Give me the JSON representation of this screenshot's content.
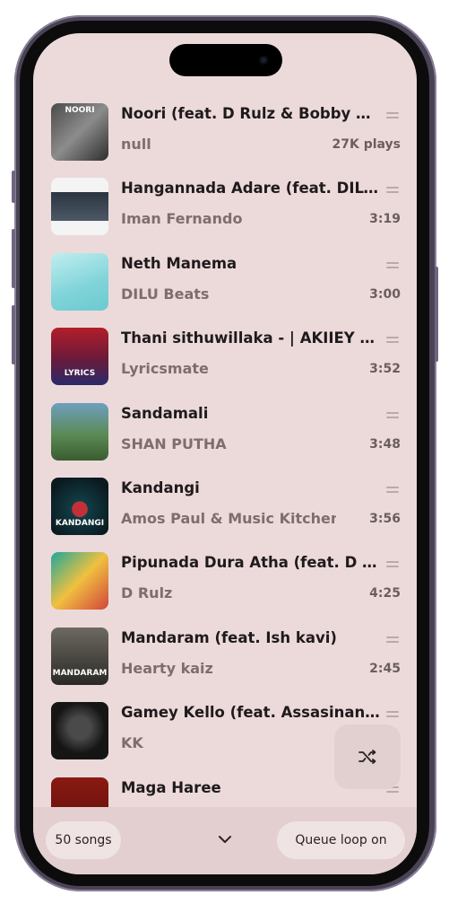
{
  "songs": [
    {
      "title": "Noori (feat. D Rulz & Bobby KY)",
      "artist": "null",
      "meta": "27K plays",
      "thumb_bg": "linear-gradient(135deg,#4a4a4a,#8c8c8c 50%,#2d2d2d)",
      "thumb_label": "NOORI"
    },
    {
      "title": "Hangannada Adare (feat. DILU B...",
      "artist": "Iman Fernando",
      "meta": "3:19",
      "thumb_bg": "linear-gradient(180deg,#f4f4f4 0%,#f4f4f4 25%,#2c3540 25%,#4b5866 75%,#f4f4f4 75%)",
      "thumb_label": ""
    },
    {
      "title": "Neth Manema",
      "artist": "DILU Beats",
      "meta": "3:00",
      "thumb_bg": "linear-gradient(160deg,#bfeef0,#7fd3d8 60%,#6ccad0)",
      "thumb_label": ""
    },
    {
      "title": "Thani sithuwillaka - | AKIIEY x US...",
      "artist": "Lyricsmate",
      "meta": "3:52",
      "thumb_bg": "linear-gradient(180deg,#b21e2a,#6a1a3a 55%,#2a2a6a)",
      "thumb_label": "LYRICS"
    },
    {
      "title": "Sandamali",
      "artist": "SHAN PUTHA",
      "meta": "3:48",
      "thumb_bg": "linear-gradient(180deg,#6e9fc0,#5b8a55 55%,#3a5c30)",
      "thumb_label": ""
    },
    {
      "title": "Kandangi",
      "artist": "Amos Paul & Music Kitchen",
      "meta": "3:56",
      "thumb_bg": "radial-gradient(circle at 50% 55%,#c4303a 0 18%,#123c44 19%,#0a1a1f 80%)",
      "thumb_label": "KANDANGI"
    },
    {
      "title": "Pipunada Dura Atha (feat. D Rulz)",
      "artist": "D Rulz",
      "meta": "4:25",
      "thumb_bg": "linear-gradient(135deg,#1fa89a,#f0c040 50%,#d0453a)",
      "thumb_label": ""
    },
    {
      "title": "Mandaram (feat. Ish kavi)",
      "artist": "Hearty kaiz",
      "meta": "2:45",
      "thumb_bg": "linear-gradient(180deg,#6d6a62,#3f3d38 70%,#2a2926)",
      "thumb_label": "MANDARAM"
    },
    {
      "title": "Gamey Kello (feat. Assasinandie)",
      "artist": "KK",
      "meta": "",
      "thumb_bg": "radial-gradient(circle at 50% 45%,#4a4a4a 0 25%,#151515 60%)",
      "thumb_label": ""
    },
    {
      "title": "Maga Haree",
      "artist": "",
      "meta": "",
      "thumb_bg": "linear-gradient(180deg,#8a1a12,#5c0f0a)",
      "thumb_label": ""
    }
  ],
  "footer": {
    "song_count": "50 songs",
    "queue_loop": "Queue loop on"
  },
  "icons": {
    "shuffle": "shuffle-icon",
    "chevron": "chevron-down-icon",
    "drag": "drag-handle-icon"
  },
  "colors": {
    "screen_bg": "#ecdadb",
    "bottom_bar": "#e3cfd0",
    "pill_bg": "#f0e3e4"
  }
}
